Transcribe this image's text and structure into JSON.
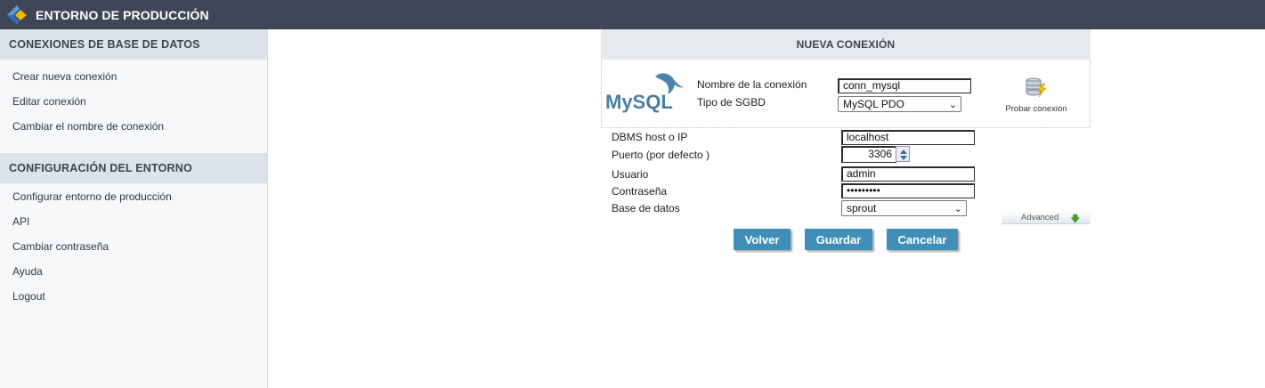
{
  "app": {
    "title": "ENTORNO DE PRODUCCIÓN",
    "logo_icon": "scriptcase-logo-icon",
    "colors": {
      "topbar": "#3f4756",
      "section_header": "#dde3ea",
      "button": "#3f8fb8"
    }
  },
  "sidebar": {
    "sections": [
      {
        "title": "CONEXIONES DE BASE DE DATOS",
        "items": [
          "Crear nueva conexión",
          "Editar conexión",
          "Cambiar el nombre de conexión"
        ]
      },
      {
        "title": "CONFIGURACIÓN DEL ENTORNO",
        "items": [
          "Configurar entorno de producción",
          "API",
          "Cambiar contraseña",
          "Ayuda",
          "Logout"
        ]
      }
    ]
  },
  "panel": {
    "title": "NUEVA CONEXIÓN",
    "mysql_logo_text": "MySQL",
    "connection_name_label": "Nombre de la conexión",
    "connection_name_value": "conn_mysql",
    "dbms_type_label": "Tipo de SGBD",
    "dbms_type_value": "MySQL PDO",
    "test_connection_label": "Probar conexión",
    "host_label": "DBMS host o IP",
    "host_value": "localhost",
    "port_label": "Puerto (por defecto )",
    "port_value": "3306",
    "user_label": "Usuario",
    "user_value": "admin",
    "password_label": "Contraseña",
    "password_value": "•••••••••",
    "database_label": "Base de datos",
    "database_value": "sprout",
    "advanced_label": "Advanced"
  },
  "buttons": {
    "back": "Volver",
    "save": "Guardar",
    "cancel": "Cancelar"
  }
}
